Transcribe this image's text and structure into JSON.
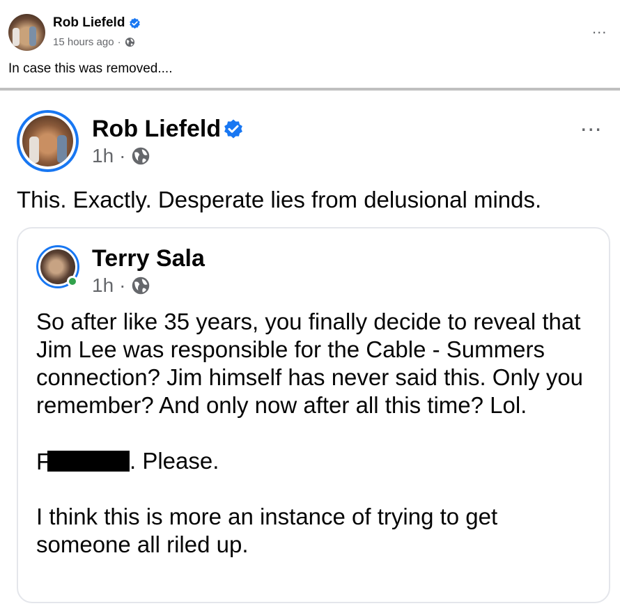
{
  "outer_post": {
    "author": "Rob Liefeld",
    "timestamp": "15 hours ago",
    "separator": "·",
    "text": "In case this was removed....",
    "more_icon": "more-horizontal-icon",
    "verified_icon": "verified-badge-icon",
    "audience_icon": "globe-icon"
  },
  "inner_post": {
    "author": "Rob Liefeld",
    "timestamp": "1h",
    "separator": "·",
    "text": "This. Exactly. Desperate lies from delusional minds.",
    "more_icon": "more-horizontal-icon"
  },
  "shared_post": {
    "author": "Terry Sala",
    "timestamp": "1h",
    "separator": "·",
    "paragraph1": "So after like 35 years, you finally decide to reveal that Jim Lee was responsible for the Cable - Summers connection?  Jim himself has never said this. Only you remember?  And only now after all this time?  Lol.",
    "paragraph2_suffix": ". Please.",
    "paragraph3": "I think this is more an instance of trying to get someone all riled up."
  },
  "colors": {
    "accent_blue": "#1877f2",
    "meta_gray": "#65676b",
    "online_green": "#31a24c"
  }
}
